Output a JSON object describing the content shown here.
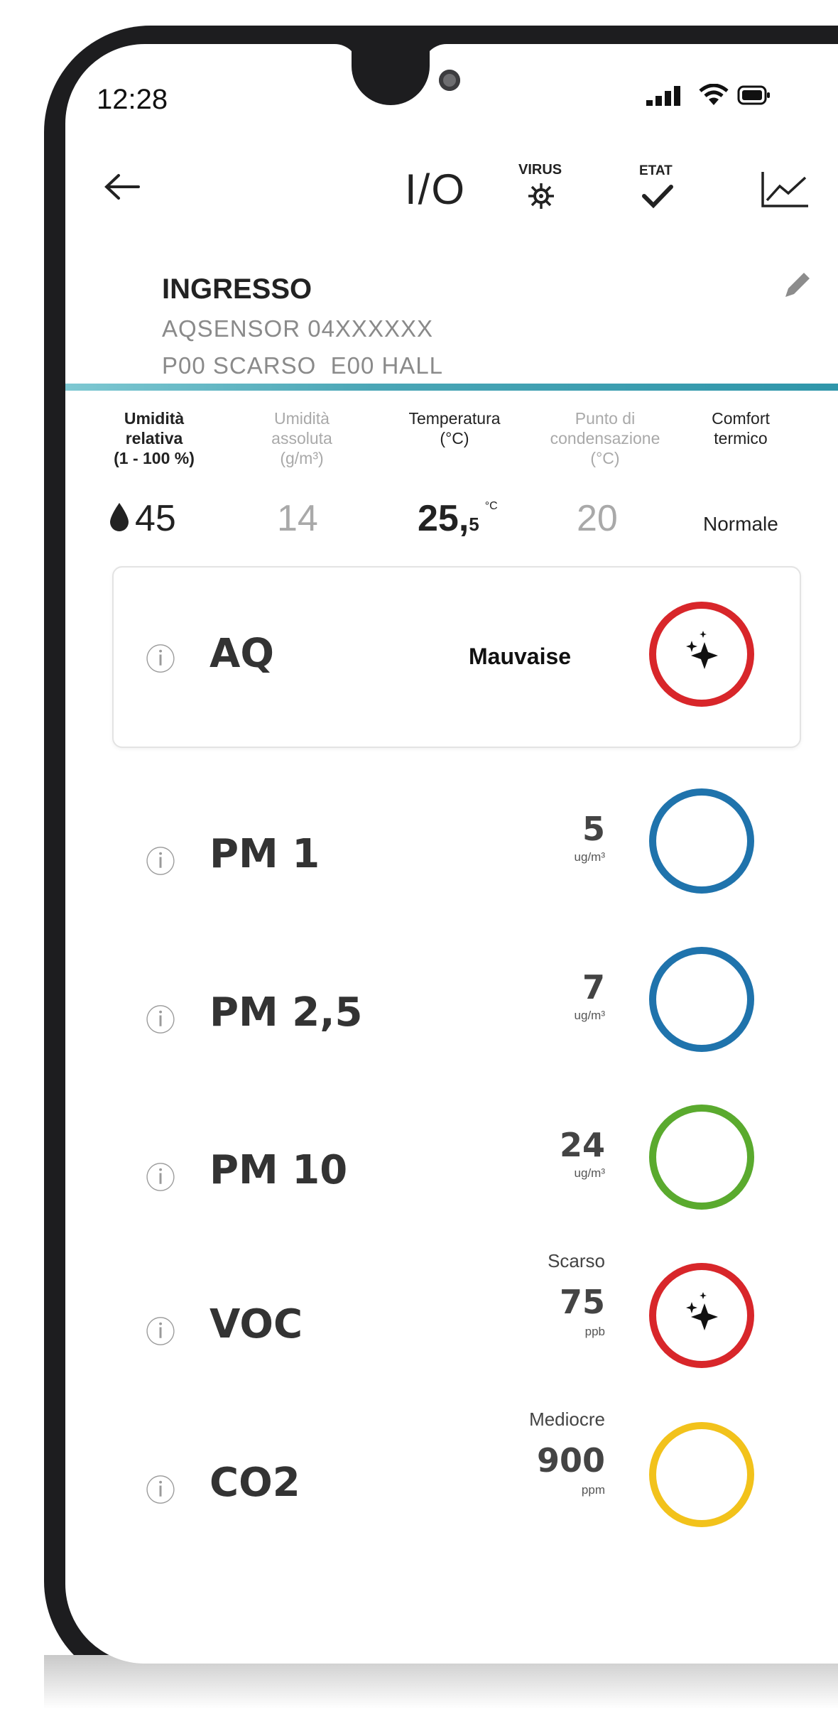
{
  "status_bar": {
    "time": "12:28"
  },
  "toolbar": {
    "io_label": "I/O",
    "virus_label": "VIRUS",
    "etat_label": "ETAT"
  },
  "location": {
    "name": "INGRESSO",
    "sensor": "AQSENSOR 04XXXXXX",
    "place": "P00 SCARSO  E00 HALL"
  },
  "metrics": [
    {
      "label1": "Umidità",
      "label2": "relativa",
      "label3": "(1 - 100 %)",
      "value": "45"
    },
    {
      "label1": "Umidità",
      "label2": "assoluta",
      "label3": "(g/m³)",
      "value": "14"
    },
    {
      "label1": "Temperatura",
      "label2": "(°C)",
      "value_int": "25,",
      "value_dec": "5",
      "unit": "°C"
    },
    {
      "label1": "Punto di",
      "label2": "condensazione",
      "label3": "(°C)",
      "value": "20"
    },
    {
      "label1": "Comfort",
      "label2": "termico",
      "value": "Normale"
    }
  ],
  "aq": {
    "info": "ⓘ",
    "name": "AQ",
    "status": "Mauvaise",
    "color": "#d8262a"
  },
  "pollutants": [
    {
      "info": "ⓘ",
      "name": "PM 1",
      "value": "5",
      "unit": "ug/m³",
      "color": "#1f73ac"
    },
    {
      "info": "ⓘ",
      "name": "PM 2,5",
      "value": "7",
      "unit": "ug/m³",
      "color": "#1f73ac"
    },
    {
      "info": "ⓘ",
      "name": "PM 10",
      "value": "24",
      "unit": "ug/m³",
      "color": "#5aaa2e"
    },
    {
      "info": "ⓘ",
      "name": "VOC",
      "status": "Scarso",
      "value": "75",
      "unit": "ppb",
      "color": "#d8262a"
    },
    {
      "info": "ⓘ",
      "name": "CO2",
      "status": "Mediocre",
      "value": "900",
      "unit": "ppm",
      "color": "#f2c21b"
    }
  ]
}
